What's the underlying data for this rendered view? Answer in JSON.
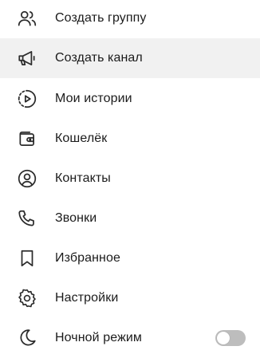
{
  "menu": {
    "items": [
      {
        "label": "Создать группу",
        "icon": "group-icon"
      },
      {
        "label": "Создать канал",
        "icon": "megaphone-icon"
      },
      {
        "label": "Мои истории",
        "icon": "stories-icon"
      },
      {
        "label": "Кошелёк",
        "icon": "wallet-icon"
      },
      {
        "label": "Контакты",
        "icon": "contact-icon"
      },
      {
        "label": "Звонки",
        "icon": "phone-icon"
      },
      {
        "label": "Избранное",
        "icon": "bookmark-icon"
      },
      {
        "label": "Настройки",
        "icon": "gear-icon"
      },
      {
        "label": "Ночной режим",
        "icon": "moon-icon"
      }
    ],
    "night_mode_enabled": false
  },
  "colors": {
    "text": "#1b1b1b",
    "icon": "#2b2b2b",
    "active_background": "#f1f1f1",
    "toggle_off": "#bdbdbd"
  }
}
